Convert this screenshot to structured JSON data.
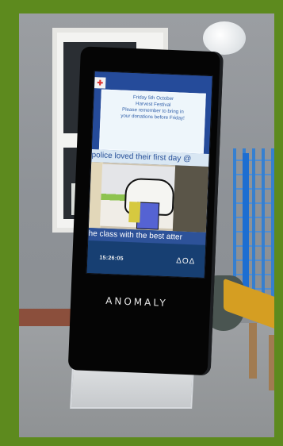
{
  "screen": {
    "message_lines": [
      "Friday 5th October",
      "Harvest Festival",
      "Please remember to bring in",
      "your donations before Friday!"
    ],
    "ticker_top": "police loved their first day @",
    "ticker_bottom": "he class with the best atter",
    "time": "15:26:05",
    "brand_small": "ΔOΔ"
  },
  "kiosk": {
    "brand": "ANOMALY"
  },
  "colors": {
    "frame": "#5d8a1e",
    "screen_blue": "#254b9a",
    "message_bg": "#eef6fb",
    "message_text": "#2f5ea8"
  }
}
